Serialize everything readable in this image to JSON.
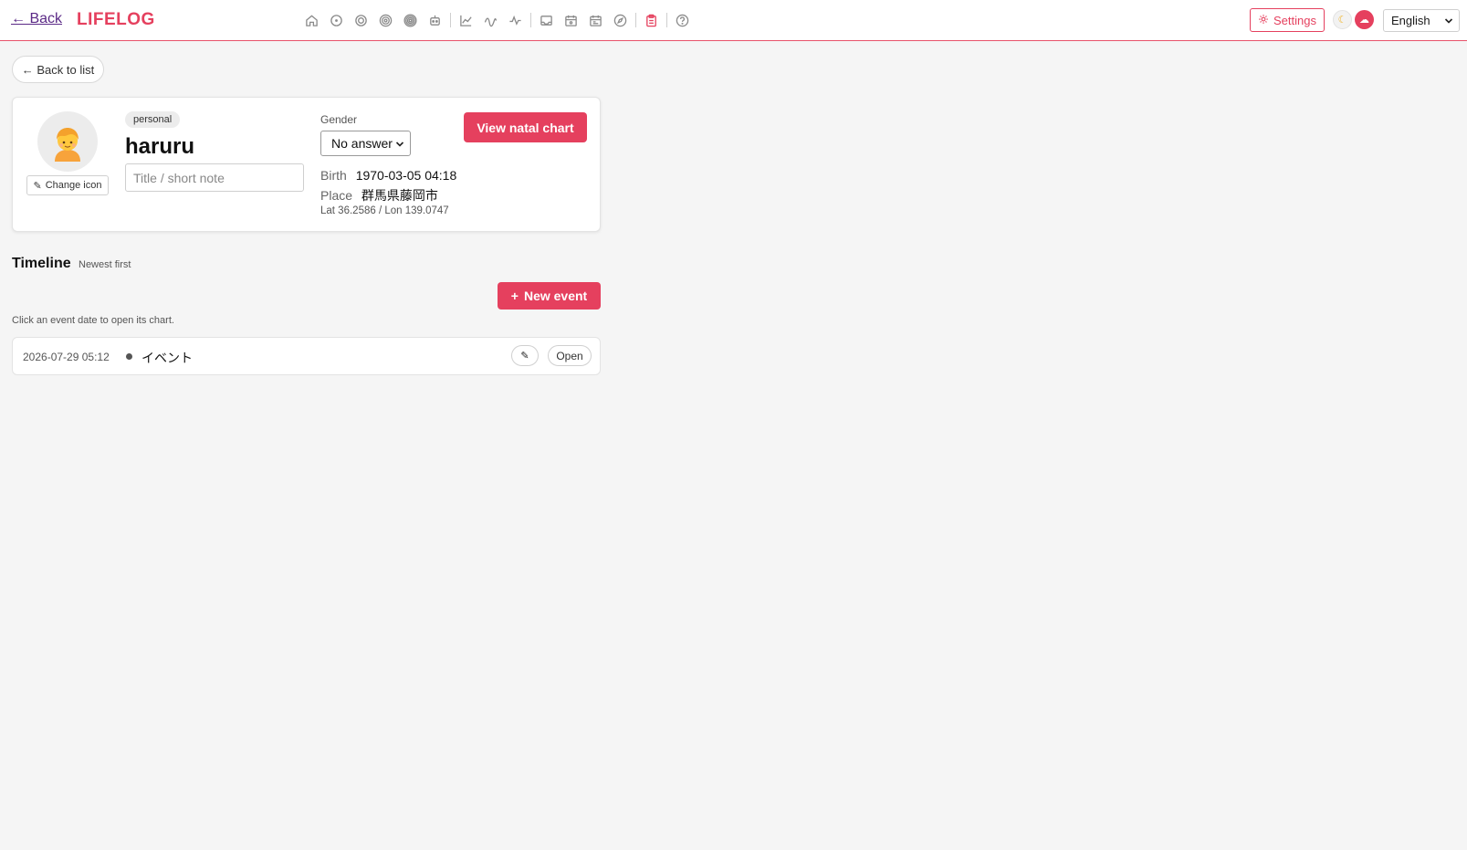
{
  "header": {
    "back_label": "← Back",
    "brand": "LIFELOG",
    "nav_icons": [
      "home-icon",
      "circle-dot-icon",
      "concentric-circle-icon",
      "double-ring-icon",
      "multi-ring-icon",
      "robot-icon",
      "line-chart-icon",
      "wave-icon",
      "pulse-icon",
      "mail-icon",
      "calendar-icon",
      "calendar-grid-icon",
      "compass-icon",
      "clipboard-icon",
      "help-icon"
    ],
    "settings_label": "Settings",
    "language_selected": "English",
    "accent_color": "#e5405e"
  },
  "back_to_list_label": "← Back to list",
  "profile": {
    "category": "personal",
    "name": "haruru",
    "title_placeholder": "Title / short note",
    "change_icon_label": "Change icon",
    "gender_label": "Gender",
    "gender_selected": "No answer",
    "birth_label": "Birth",
    "birth_value": "1970-03-05 04:18",
    "place_label": "Place",
    "place_value": "群馬県藤岡市",
    "latlon": "Lat 36.2586 / Lon 139.0747",
    "natal_chart_label": "View natal chart"
  },
  "timeline": {
    "title": "Timeline",
    "order_label": "Newest first",
    "new_event_label": "New event",
    "hint": "Click an event date to open its chart.",
    "events": [
      {
        "date": "2026-07-29 05:12",
        "title": "イベント",
        "open_label": "Open"
      }
    ]
  }
}
